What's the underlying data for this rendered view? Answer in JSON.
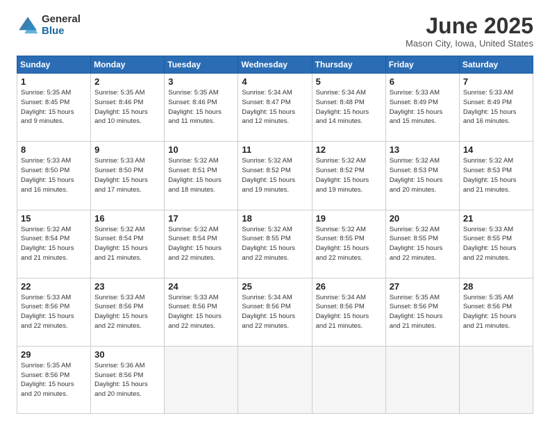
{
  "logo": {
    "general": "General",
    "blue": "Blue"
  },
  "header": {
    "title": "June 2025",
    "subtitle": "Mason City, Iowa, United States"
  },
  "weekdays": [
    "Sunday",
    "Monday",
    "Tuesday",
    "Wednesday",
    "Thursday",
    "Friday",
    "Saturday"
  ],
  "weeks": [
    [
      {
        "day": "1",
        "info": "Sunrise: 5:35 AM\nSunset: 8:45 PM\nDaylight: 15 hours\nand 9 minutes."
      },
      {
        "day": "2",
        "info": "Sunrise: 5:35 AM\nSunset: 8:46 PM\nDaylight: 15 hours\nand 10 minutes."
      },
      {
        "day": "3",
        "info": "Sunrise: 5:35 AM\nSunset: 8:46 PM\nDaylight: 15 hours\nand 11 minutes."
      },
      {
        "day": "4",
        "info": "Sunrise: 5:34 AM\nSunset: 8:47 PM\nDaylight: 15 hours\nand 12 minutes."
      },
      {
        "day": "5",
        "info": "Sunrise: 5:34 AM\nSunset: 8:48 PM\nDaylight: 15 hours\nand 14 minutes."
      },
      {
        "day": "6",
        "info": "Sunrise: 5:33 AM\nSunset: 8:49 PM\nDaylight: 15 hours\nand 15 minutes."
      },
      {
        "day": "7",
        "info": "Sunrise: 5:33 AM\nSunset: 8:49 PM\nDaylight: 15 hours\nand 16 minutes."
      }
    ],
    [
      {
        "day": "8",
        "info": "Sunrise: 5:33 AM\nSunset: 8:50 PM\nDaylight: 15 hours\nand 16 minutes."
      },
      {
        "day": "9",
        "info": "Sunrise: 5:33 AM\nSunset: 8:50 PM\nDaylight: 15 hours\nand 17 minutes."
      },
      {
        "day": "10",
        "info": "Sunrise: 5:32 AM\nSunset: 8:51 PM\nDaylight: 15 hours\nand 18 minutes."
      },
      {
        "day": "11",
        "info": "Sunrise: 5:32 AM\nSunset: 8:52 PM\nDaylight: 15 hours\nand 19 minutes."
      },
      {
        "day": "12",
        "info": "Sunrise: 5:32 AM\nSunset: 8:52 PM\nDaylight: 15 hours\nand 19 minutes."
      },
      {
        "day": "13",
        "info": "Sunrise: 5:32 AM\nSunset: 8:53 PM\nDaylight: 15 hours\nand 20 minutes."
      },
      {
        "day": "14",
        "info": "Sunrise: 5:32 AM\nSunset: 8:53 PM\nDaylight: 15 hours\nand 21 minutes."
      }
    ],
    [
      {
        "day": "15",
        "info": "Sunrise: 5:32 AM\nSunset: 8:54 PM\nDaylight: 15 hours\nand 21 minutes."
      },
      {
        "day": "16",
        "info": "Sunrise: 5:32 AM\nSunset: 8:54 PM\nDaylight: 15 hours\nand 21 minutes."
      },
      {
        "day": "17",
        "info": "Sunrise: 5:32 AM\nSunset: 8:54 PM\nDaylight: 15 hours\nand 22 minutes."
      },
      {
        "day": "18",
        "info": "Sunrise: 5:32 AM\nSunset: 8:55 PM\nDaylight: 15 hours\nand 22 minutes."
      },
      {
        "day": "19",
        "info": "Sunrise: 5:32 AM\nSunset: 8:55 PM\nDaylight: 15 hours\nand 22 minutes."
      },
      {
        "day": "20",
        "info": "Sunrise: 5:32 AM\nSunset: 8:55 PM\nDaylight: 15 hours\nand 22 minutes."
      },
      {
        "day": "21",
        "info": "Sunrise: 5:33 AM\nSunset: 8:55 PM\nDaylight: 15 hours\nand 22 minutes."
      }
    ],
    [
      {
        "day": "22",
        "info": "Sunrise: 5:33 AM\nSunset: 8:56 PM\nDaylight: 15 hours\nand 22 minutes."
      },
      {
        "day": "23",
        "info": "Sunrise: 5:33 AM\nSunset: 8:56 PM\nDaylight: 15 hours\nand 22 minutes."
      },
      {
        "day": "24",
        "info": "Sunrise: 5:33 AM\nSunset: 8:56 PM\nDaylight: 15 hours\nand 22 minutes."
      },
      {
        "day": "25",
        "info": "Sunrise: 5:34 AM\nSunset: 8:56 PM\nDaylight: 15 hours\nand 22 minutes."
      },
      {
        "day": "26",
        "info": "Sunrise: 5:34 AM\nSunset: 8:56 PM\nDaylight: 15 hours\nand 21 minutes."
      },
      {
        "day": "27",
        "info": "Sunrise: 5:35 AM\nSunset: 8:56 PM\nDaylight: 15 hours\nand 21 minutes."
      },
      {
        "day": "28",
        "info": "Sunrise: 5:35 AM\nSunset: 8:56 PM\nDaylight: 15 hours\nand 21 minutes."
      }
    ],
    [
      {
        "day": "29",
        "info": "Sunrise: 5:35 AM\nSunset: 8:56 PM\nDaylight: 15 hours\nand 20 minutes."
      },
      {
        "day": "30",
        "info": "Sunrise: 5:36 AM\nSunset: 8:56 PM\nDaylight: 15 hours\nand 20 minutes."
      },
      {
        "day": "",
        "info": ""
      },
      {
        "day": "",
        "info": ""
      },
      {
        "day": "",
        "info": ""
      },
      {
        "day": "",
        "info": ""
      },
      {
        "day": "",
        "info": ""
      }
    ]
  ]
}
